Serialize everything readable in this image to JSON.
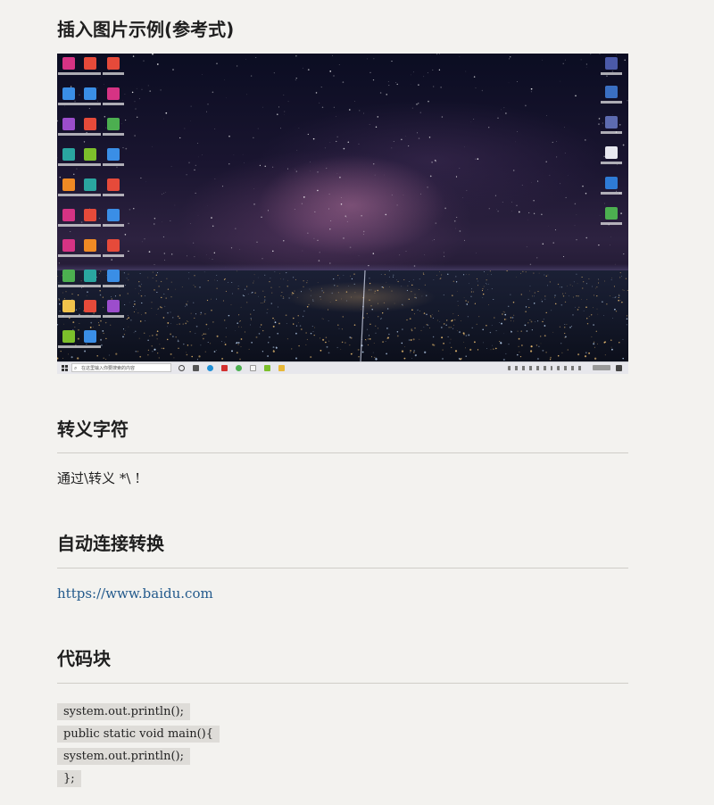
{
  "sections": {
    "image": {
      "heading": "插入图片示例(参考式)",
      "taskbar_search": "在这里输入你要搜索的内容"
    },
    "escape": {
      "heading": "转义字符",
      "text": "通过\\转义 *\\ !"
    },
    "autolink": {
      "heading": "自动连接转换",
      "link": "https://www.baidu.com"
    },
    "code": {
      "heading": "代码块",
      "lines": [
        "system.out.println();",
        "public static void main(){",
        "system.out.println();",
        "};"
      ]
    }
  },
  "colors": {
    "page_background": "#f3f2ef",
    "link": "#235a8c",
    "code_background": "#dedcd8",
    "rule": "#cfcdc8"
  },
  "icons": {
    "start": "windows-start-icon",
    "search": "search-icon"
  }
}
